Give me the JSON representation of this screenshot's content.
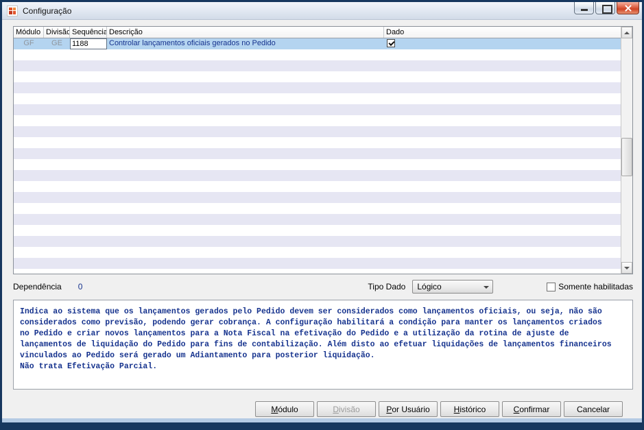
{
  "window": {
    "title": "Configuração",
    "border_color": "#17375e"
  },
  "grid": {
    "columns": [
      "Módulo",
      "Divisão",
      "Sequência",
      "Descrição",
      "Dado"
    ],
    "selected_row": {
      "modulo": "GF",
      "divisao": "GE",
      "sequencia": "1188",
      "descricao": "Controlar lançamentos oficiais gerados no Pedido",
      "dado_checked": true
    },
    "empty_row_count": 21
  },
  "fields": {
    "dependencia_label": "Dependência",
    "dependencia_value": "0",
    "tipo_dado_label": "Tipo Dado",
    "tipo_dado_value": "Lógico",
    "somente_habilitadas_label": "Somente habilitadas",
    "somente_habilitadas_checked": false
  },
  "description": {
    "text": "Indica ao sistema que os lançamentos gerados pelo Pedido devem ser considerados como lançamentos oficiais, ou seja, não são\nconsiderados como previsão, podendo gerar cobrança. A configuração habilitará a condição para manter os lançamentos criados\nno Pedido e criar novos lançamentos para a Nota Fiscal na efetivação do Pedido e a utilização da rotina de ajuste de\nlançamentos de liquidação do Pedido para fins de contabilização. Além disto ao efetuar liquidações de lançamentos financeiros\nvinculados ao Pedido será gerado um Adiantamento para posterior liquidação.\nNão trata Efetivação Parcial."
  },
  "buttons": [
    {
      "name": "modulo-button",
      "label": "Módulo",
      "enabled": true,
      "accel": 0
    },
    {
      "name": "divisao-button",
      "label": "Divisão",
      "enabled": false,
      "accel": 0
    },
    {
      "name": "por-usuario-button",
      "label": "Por Usuário",
      "enabled": true,
      "accel": 0
    },
    {
      "name": "historico-button",
      "label": "Histórico",
      "enabled": true,
      "accel": 0
    },
    {
      "name": "confirmar-button",
      "label": "Confirmar",
      "enabled": true,
      "accel": 0
    },
    {
      "name": "cancelar-button",
      "label": "Cancelar",
      "enabled": true,
      "accel": null
    }
  ],
  "colors": {
    "selected_row": "#b4d4f0",
    "stripe_row": "#e6e6f3",
    "navy_text": "#16338e",
    "titlebar": "#dde4ee",
    "close_button": "#cf4426",
    "window_border": "#17375e"
  },
  "icons": {
    "minimize-icon": "–",
    "maximize-icon": "□",
    "close-icon": "✕",
    "chevron-down-icon": "▼",
    "check-icon": "✓",
    "scroll-up-icon": "▲",
    "scroll-down-icon": "▼"
  }
}
